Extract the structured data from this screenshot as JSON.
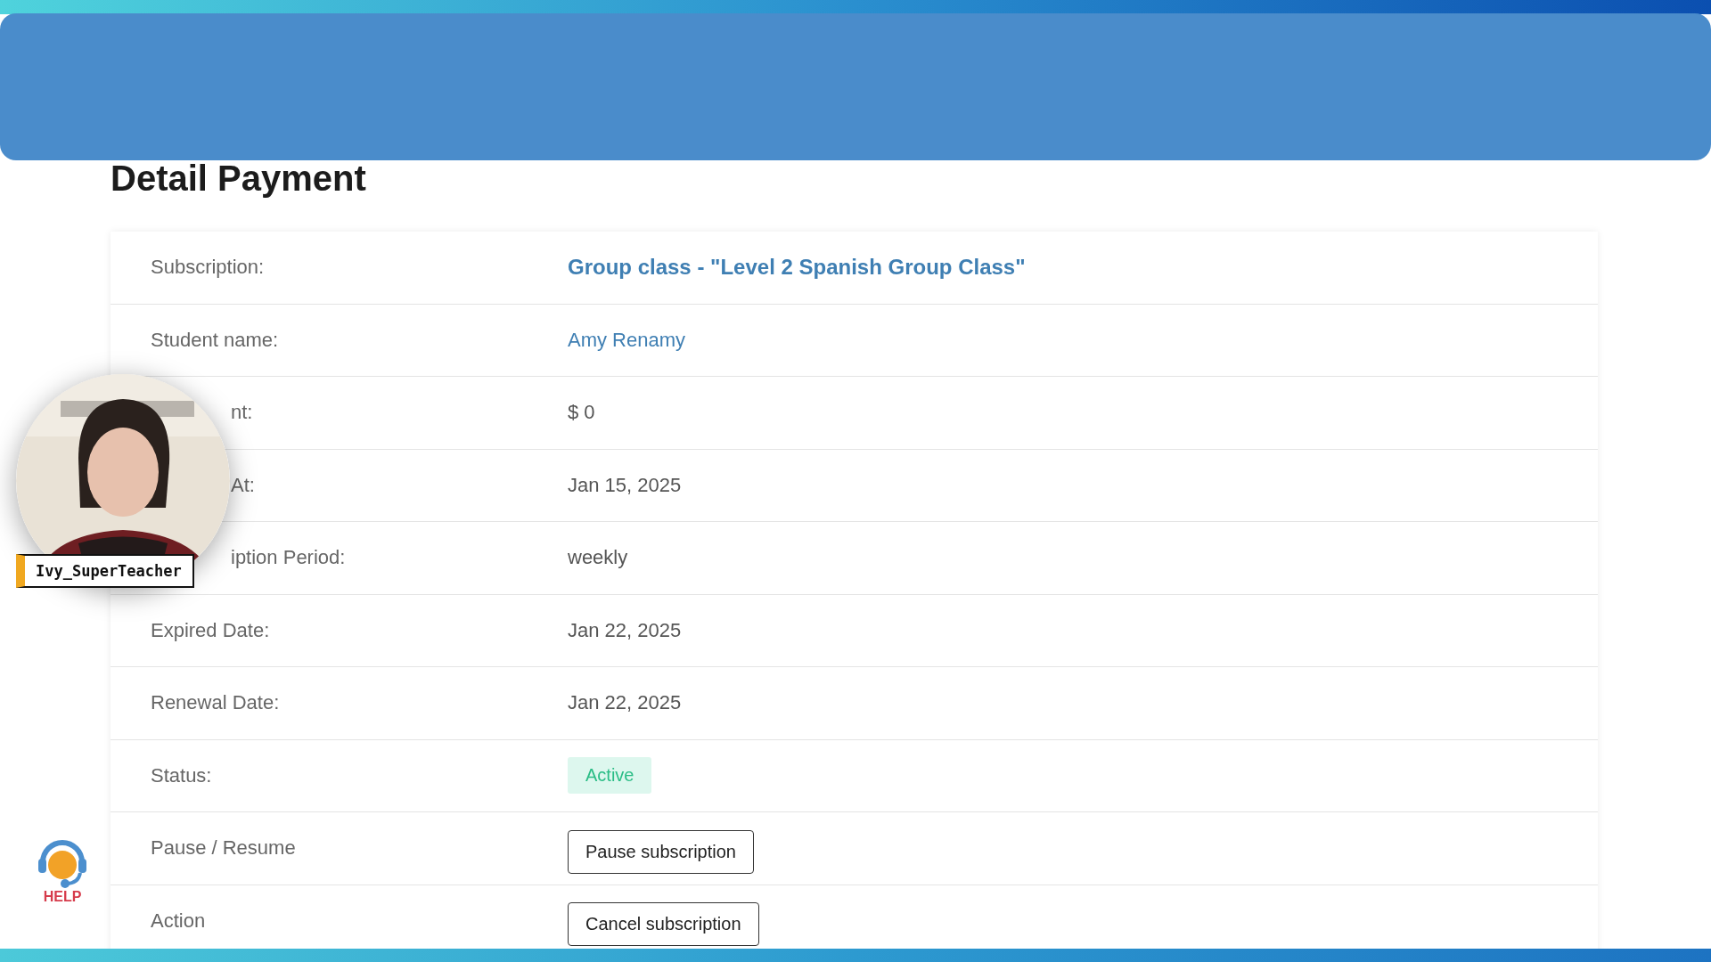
{
  "page": {
    "title": "Detail Payment"
  },
  "rows": [
    {
      "label": "Subscription:",
      "label_covered": false,
      "kind": "title-link",
      "value": "Group class - \"Level 2 Spanish Group Class\""
    },
    {
      "label": "Student name:",
      "label_covered": false,
      "kind": "link",
      "value": "Amy Renamy"
    },
    {
      "label": "nt:",
      "label_covered": true,
      "kind": "text",
      "value": "$ 0"
    },
    {
      "label": "At:",
      "label_covered": true,
      "kind": "text",
      "value": "Jan 15, 2025"
    },
    {
      "label": "iption Period:",
      "label_covered": true,
      "kind": "text",
      "value": "weekly"
    },
    {
      "label": "Expired Date:",
      "label_covered": false,
      "kind": "text",
      "value": "Jan 22, 2025"
    },
    {
      "label": "Renewal Date:",
      "label_covered": false,
      "kind": "text",
      "value": "Jan 22, 2025"
    },
    {
      "label": "Status:",
      "label_covered": false,
      "kind": "badge",
      "value": "Active"
    },
    {
      "label": "Pause / Resume",
      "label_covered": false,
      "kind": "button",
      "value": "Pause subscription"
    },
    {
      "label": "Action",
      "label_covered": false,
      "kind": "button",
      "value": "Cancel subscription"
    }
  ],
  "webcam": {
    "kind": "picture",
    "name": "Ivy_SuperTeacher"
  },
  "help": {
    "label": "HELP"
  }
}
